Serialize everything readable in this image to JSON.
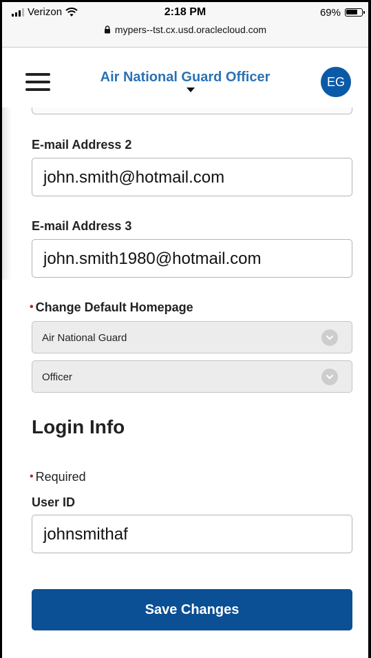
{
  "status_bar": {
    "carrier": "Verizon",
    "time": "2:18 PM",
    "battery_percent": "69%",
    "url": "mypers--tst.cx.usd.oraclecloud.com"
  },
  "header": {
    "title": "Air National Guard Officer",
    "avatar_initials": "EG"
  },
  "form": {
    "email2": {
      "label": "E-mail Address 2",
      "value": "john.smith@hotmail.com"
    },
    "email3": {
      "label": "E-mail Address 3",
      "value": "john.smith1980@hotmail.com"
    },
    "homepage": {
      "label": "Change Default Homepage",
      "select1": "Air National Guard",
      "select2": "Officer"
    },
    "login_section_title": "Login Info",
    "required_note": "Required",
    "user_id": {
      "label": "User ID",
      "value": "johnsmithaf"
    },
    "save_label": "Save Changes"
  },
  "colors": {
    "primary_blue": "#0b4f94",
    "title_blue": "#2a72b5",
    "required_red": "#b22222"
  }
}
